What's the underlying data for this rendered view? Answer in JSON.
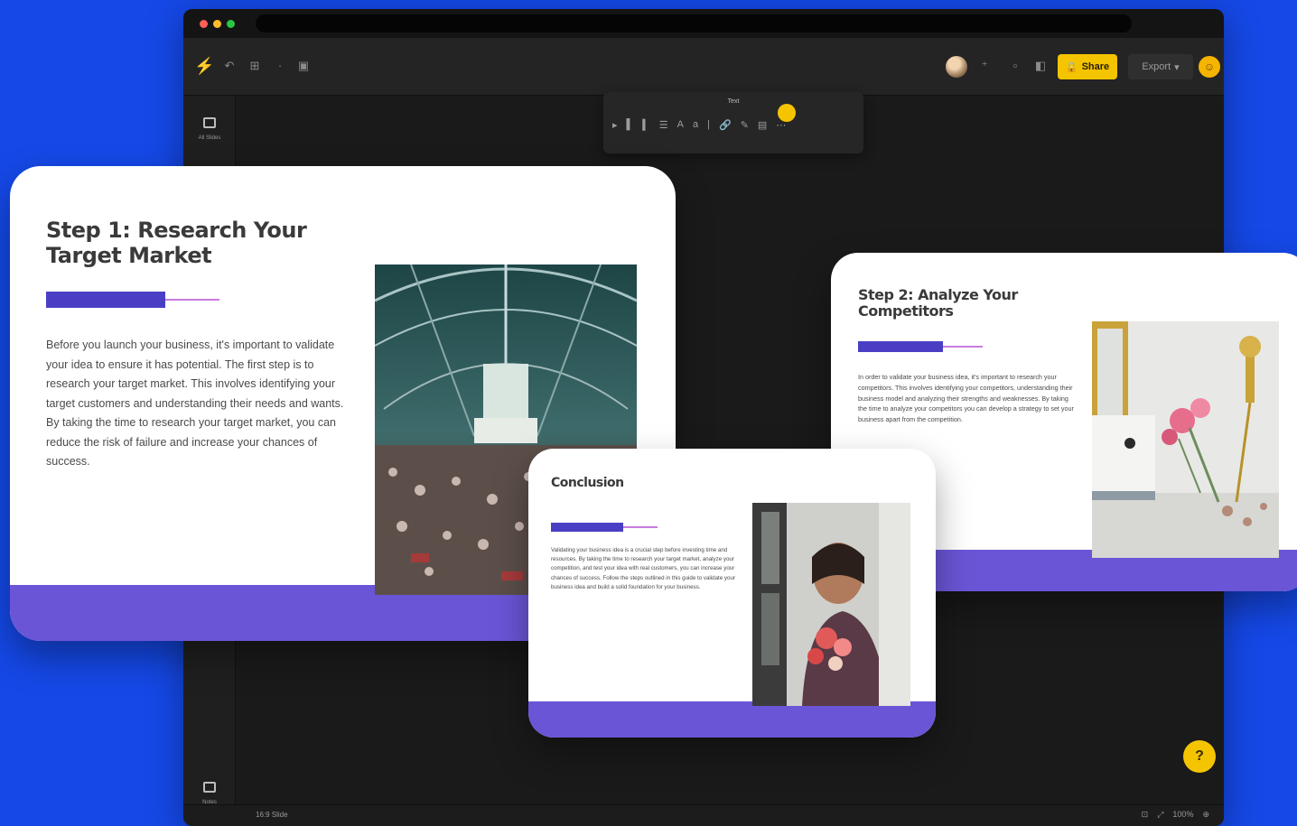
{
  "app": {
    "toolbar": {
      "share_label": "Share",
      "export_label": "Export",
      "user_initial": "☺"
    },
    "left_rail": {
      "top_item_label": "All Slides",
      "bottom_item_label": "Notes"
    },
    "format_bar": {
      "title": "Text"
    },
    "statusbar": {
      "view_label": "16:9 Slide",
      "zoom": "100%"
    },
    "help_label": "?"
  },
  "slides": [
    {
      "title": "Step 1: Research Your Target Market",
      "body": "Before you launch your business, it's important to validate your idea to ensure it has potential. The first step is to research your target market. This involves identifying your target customers and understanding their needs and wants. By taking the time to research your target market, you can reduce the risk of failure and increase your chances of success.",
      "image": "market-hall-photo"
    },
    {
      "title": "Step 2: Analyze Your Competitors",
      "body": "In order to validate your business idea, it's important to research your competitors. This involves identifying your competitors, understanding their business model and analyzing their strengths and weaknesses. By taking the time to analyze your competitors you can develop a strategy to set your business apart from the competition.",
      "image": "desk-flowers-photo"
    },
    {
      "title": "Conclusion",
      "body": "Validating your business idea is a crucial step before investing time and resources. By taking the time to research your target market, analyze your competition, and test your idea with real customers, you can increase your chances of success. Follow the steps outlined in this guide to validate your business idea and build a solid foundation for your business.",
      "image": "woman-smiling-photo"
    }
  ],
  "colors": {
    "background": "#1548e6",
    "accent_yellow": "#f5c400",
    "slide_footer": "#6a55d6",
    "accent_bar": "#4a3fc4"
  }
}
